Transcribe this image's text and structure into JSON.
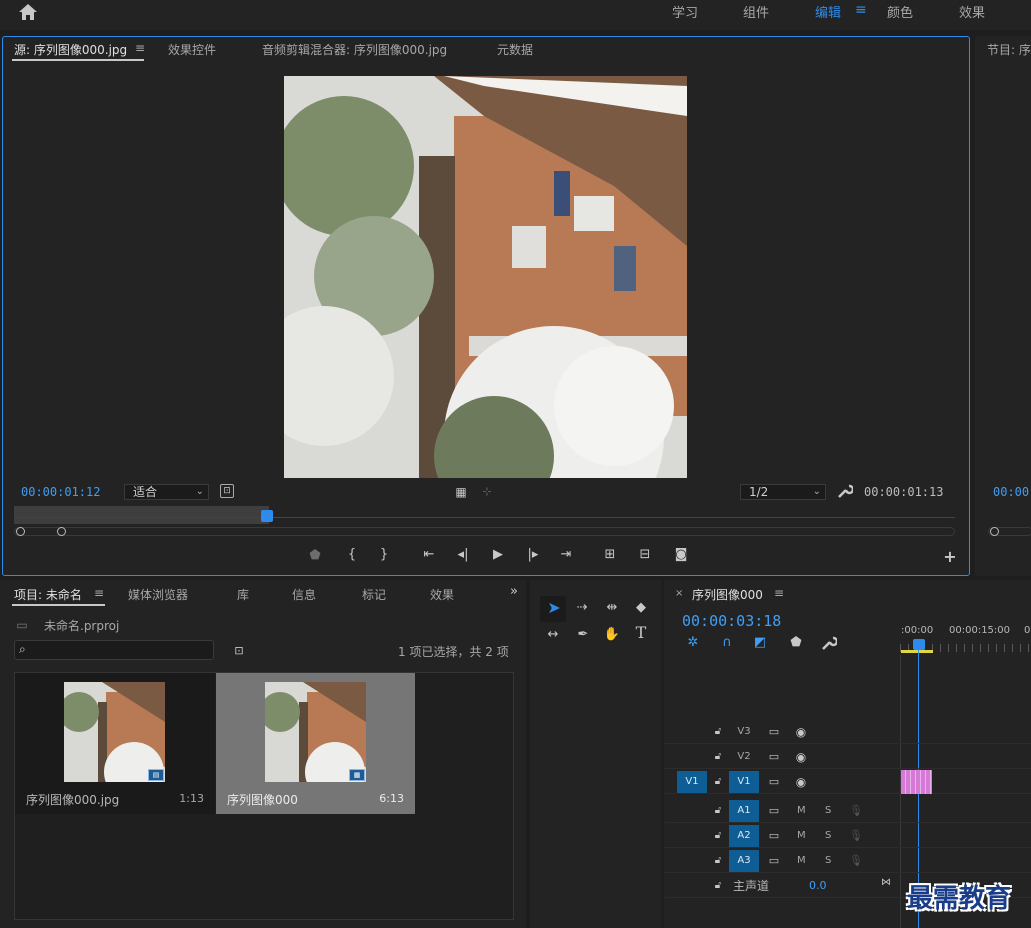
{
  "topbar": {
    "tabs": [
      {
        "label": "学习",
        "active": false
      },
      {
        "label": "组件",
        "active": false
      },
      {
        "label": "编辑",
        "active": true
      },
      {
        "label": "颜色",
        "active": false
      },
      {
        "label": "效果",
        "active": false
      }
    ]
  },
  "source_panel": {
    "tabs": [
      {
        "label": "源: 序列图像000.jpg",
        "active": true
      },
      {
        "label": "效果控件",
        "active": false
      },
      {
        "label": "音频剪辑混合器: 序列图像000.jpg",
        "active": false
      },
      {
        "label": "元数据",
        "active": false
      }
    ],
    "timecode_in": "00:00:01:12",
    "timecode_out": "00:00:01:13",
    "fit_select": "适合",
    "resolution_select": "1/2"
  },
  "program_panel": {
    "tab_label": "节目: 序",
    "timecode": "00:00"
  },
  "project_panel": {
    "tabs": [
      {
        "label": "项目: 未命名",
        "active": true
      },
      {
        "label": "媒体浏览器",
        "active": false
      },
      {
        "label": "库",
        "active": false
      },
      {
        "label": "信息",
        "active": false
      },
      {
        "label": "标记",
        "active": false
      },
      {
        "label": "效果",
        "active": false
      }
    ],
    "project_file": "未命名.prproj",
    "search_placeholder": "",
    "selection_status": "1 项已选择，共 2 项",
    "items": [
      {
        "name": "序列图像000.jpg",
        "duration": "1:13",
        "selected": false
      },
      {
        "name": "序列图像000",
        "duration": "6:13",
        "selected": true
      }
    ]
  },
  "timeline_panel": {
    "sequence_name": "序列图像000",
    "timecode": "00:00:03:18",
    "ruler_labels": [
      ":00:00",
      "00:00:15:00",
      "0"
    ],
    "video_tracks": [
      {
        "name": "V3",
        "source_patch": ""
      },
      {
        "name": "V2",
        "source_patch": ""
      },
      {
        "name": "V1",
        "source_patch": "V1"
      }
    ],
    "audio_tracks": [
      {
        "name": "A1",
        "m": "M",
        "s": "S"
      },
      {
        "name": "A2",
        "m": "M",
        "s": "S"
      },
      {
        "name": "A3",
        "m": "M",
        "s": "S"
      }
    ],
    "master": {
      "label": "主声道",
      "value": "0.0"
    }
  },
  "watermark": "最需教育",
  "colors": {
    "accent": "#2d8ceb",
    "panel": "#232323",
    "clip": "#d57ad6",
    "track_on": "#0e5d94"
  }
}
